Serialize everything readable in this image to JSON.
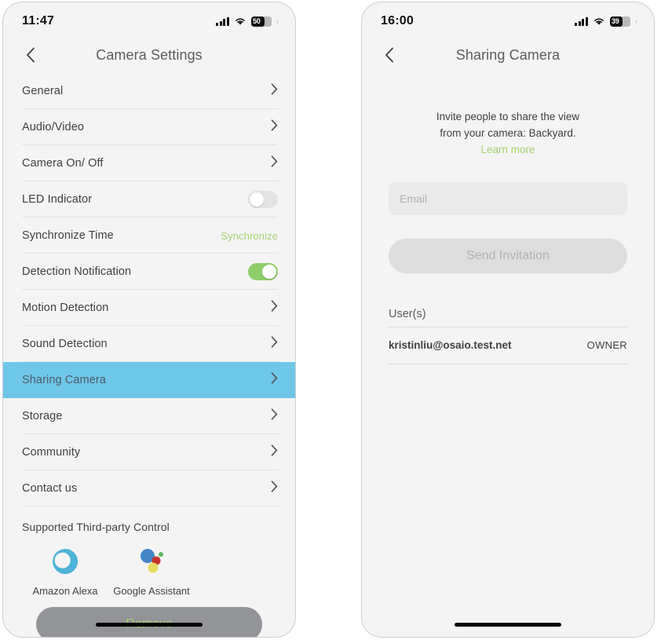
{
  "left_phone": {
    "status_bar": {
      "time": "11:47",
      "battery_percent": "50",
      "signal_icon": "cellular-signal-icon",
      "wifi_icon": "wifi-icon",
      "battery_icon": "battery-icon"
    },
    "nav": {
      "back_icon": "chevron-left-icon",
      "title": "Camera Settings"
    },
    "rows": [
      {
        "label": "General",
        "type": "chevron"
      },
      {
        "label": "Audio/Video",
        "type": "chevron"
      },
      {
        "label": "Camera On/ Off",
        "type": "chevron"
      },
      {
        "label": "LED Indicator",
        "type": "toggle",
        "toggle_on": false
      },
      {
        "label": "Synchronize Time",
        "type": "value",
        "value": "Synchronize"
      },
      {
        "label": "Detection Notification",
        "type": "toggle",
        "toggle_on": true
      },
      {
        "label": "Motion Detection",
        "type": "chevron"
      },
      {
        "label": "Sound Detection",
        "type": "chevron"
      },
      {
        "label": "Sharing Camera",
        "type": "chevron",
        "highlighted": true
      },
      {
        "label": "Storage",
        "type": "chevron"
      },
      {
        "label": "Community",
        "type": "chevron"
      },
      {
        "label": "Contact us",
        "type": "chevron"
      }
    ],
    "third_party": {
      "title": "Supported Third-party Control",
      "items": [
        {
          "label": "Amazon Alexa",
          "icon": "amazon-alexa-icon"
        },
        {
          "label": "Google Assistant",
          "icon": "google-assistant-icon"
        }
      ]
    },
    "remove_button": "Remove"
  },
  "right_phone": {
    "status_bar": {
      "time": "16:00",
      "battery_percent": "39",
      "signal_icon": "cellular-signal-icon",
      "wifi_icon": "wifi-icon",
      "battery_icon": "battery-icon"
    },
    "nav": {
      "back_icon": "chevron-left-icon",
      "title": "Sharing Camera"
    },
    "intro_line1": "Invite people to share the view",
    "intro_line2": "from your camera: Backyard.",
    "learn_more": "Learn more",
    "email_placeholder": "Email",
    "email_value": "",
    "send_button": "Send Invitation",
    "users_header": "User(s)",
    "users": [
      {
        "email": "kristinliu@osaio.test.net",
        "role": "OWNER"
      }
    ]
  },
  "colors": {
    "highlight_blue": "#6ec7e8",
    "accent_green": "#a6d370",
    "toggle_on_green": "#90ce6a",
    "screen_bg": "#f4f4f4"
  }
}
